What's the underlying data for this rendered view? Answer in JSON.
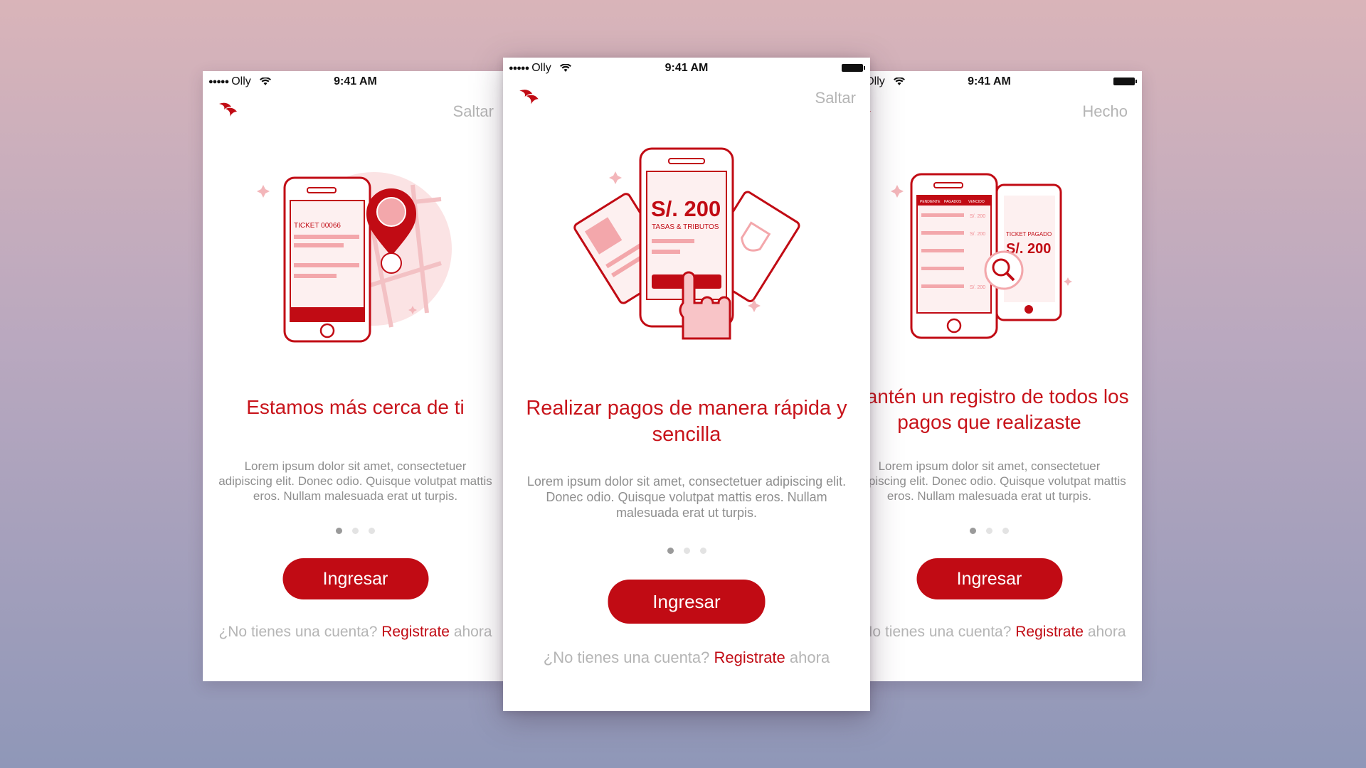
{
  "status_bar": {
    "carrier_dots": "●●●●●",
    "carrier": "Olly",
    "time": "9:41 AM"
  },
  "colors": {
    "brand_red": "#c10b14",
    "title_red": "#c8141b",
    "muted_gray": "#b5b5b5"
  },
  "screens": [
    {
      "skip_label": "Saltar",
      "illustration": "map-pin-phone-illustration",
      "ticket_label": "TICKET 00066",
      "title": "Estamos más cerca de ti",
      "body": "Lorem ipsum dolor sit amet, consectetuer adipiscing elit. Donec odio. Quisque volutpat mattis eros. Nullam malesuada erat ut turpis.",
      "button": "Ingresar",
      "signup_prefix": "¿No tienes una cuenta?",
      "signup_link": "Registrate",
      "signup_suffix": "ahora"
    },
    {
      "skip_label": "Saltar",
      "illustration": "payment-phone-illustration",
      "amount": "S/. 200",
      "amount_caption": "TASAS & TRIBUTOS",
      "title": "Realizar pagos de manera rápida y sencilla",
      "body": "Lorem ipsum dolor sit amet, consectetuer adipiscing elit. Donec odio. Quisque volutpat mattis eros. Nullam malesuada erat ut turpis.",
      "button": "Ingresar",
      "signup_prefix": "¿No tienes una cuenta?",
      "signup_link": "Registrate",
      "signup_suffix": "ahora"
    },
    {
      "skip_label": "Hecho",
      "illustration": "payment-history-illustration",
      "tabs": [
        "PENDIENTE",
        "PAGADOS",
        "VENCIDO"
      ],
      "row_amount": "S/. 200",
      "paid_label": "TICKET PAGADO",
      "paid_amount": "S/. 200",
      "title": "Mantén un registro de todos los pagos que realizaste",
      "body": "Lorem ipsum dolor sit amet, consectetuer adipiscing elit. Donec odio. Quisque volutpat mattis eros. Nullam malesuada erat ut turpis.",
      "button": "Ingresar",
      "signup_prefix": "¿No tienes una cuenta?",
      "signup_link": "Registrate",
      "signup_suffix": "ahora"
    }
  ]
}
